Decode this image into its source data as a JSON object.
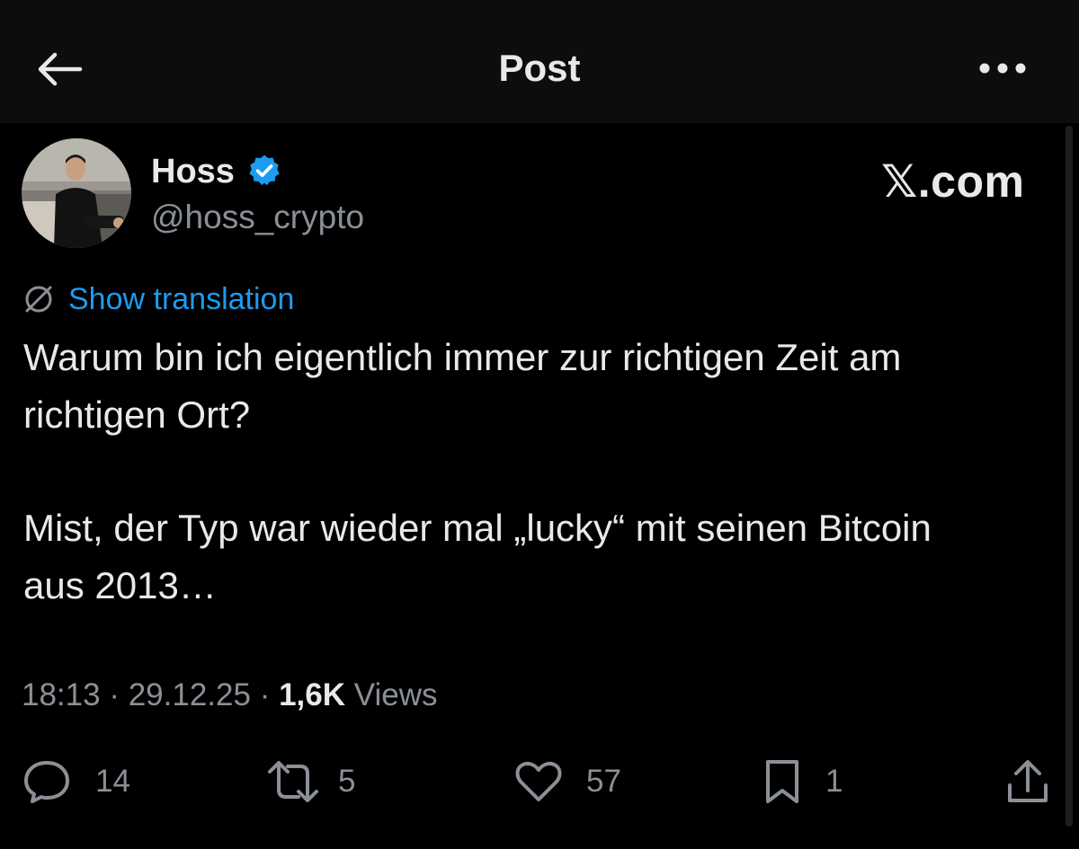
{
  "header": {
    "title": "Post",
    "back_icon": "arrow-left-icon",
    "more_icon": "more-dots-icon"
  },
  "author": {
    "display_name": "Hoss",
    "handle": "@hoss_crypto",
    "verified_color": "#1d9bf0"
  },
  "watermark": "𝕏.com",
  "translation": {
    "label": "Show translation",
    "icon": "globe-icon",
    "accent": "#1d9bf0"
  },
  "post": {
    "line1": "Warum bin ich eigentlich immer zur richtigen Zeit am",
    "line2": "richtigen Ort?",
    "line3": "Mist, der Typ war wieder mal „lucky“ mit seinen Bitcoin",
    "line4": "aus 2013…"
  },
  "meta": {
    "time": "18:13",
    "date": "29.12.25",
    "separator": "·",
    "views_count": "1,6K",
    "views_label": "Views"
  },
  "actions": {
    "replies": "14",
    "reposts": "5",
    "likes": "57",
    "bookmarks": "1"
  }
}
